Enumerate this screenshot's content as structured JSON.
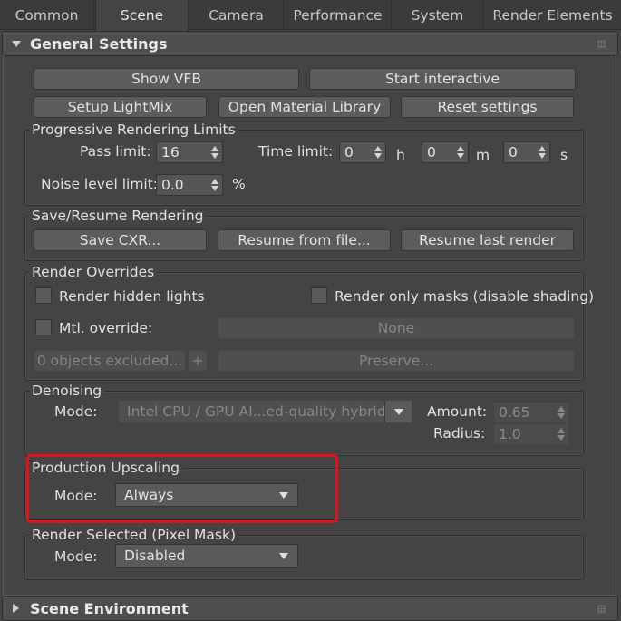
{
  "tabs": [
    "Common",
    "Scene",
    "Camera",
    "Performance",
    "System",
    "Render Elements"
  ],
  "active_tab": "Scene",
  "general": {
    "title": "General Settings",
    "show_vfb": "Show VFB",
    "start_interactive": "Start interactive",
    "setup_lightmix": "Setup LightMix",
    "open_material_library": "Open Material Library",
    "reset_settings": "Reset settings"
  },
  "progressive": {
    "title": "Progressive Rendering Limits",
    "pass_limit_label": "Pass limit:",
    "pass_limit_value": "16",
    "time_limit_label": "Time limit:",
    "hours_value": "0",
    "hours_unit": "h",
    "minutes_value": "0",
    "minutes_unit": "m",
    "seconds_value": "0",
    "seconds_unit": "s",
    "noise_label": "Noise level limit:",
    "noise_value": "0.0",
    "noise_unit": "%"
  },
  "save_resume": {
    "title": "Save/Resume Rendering",
    "save_cxr": "Save CXR...",
    "resume_from_file": "Resume from file...",
    "resume_last": "Resume last render"
  },
  "overrides": {
    "title": "Render Overrides",
    "render_hidden_lights": "Render hidden lights",
    "render_only_masks": "Render only masks (disable shading)",
    "mtl_override": "Mtl. override:",
    "mtl_value": "None",
    "objects_excluded": "0 objects excluded...",
    "add": "+",
    "preserve": "Preserve..."
  },
  "denoising": {
    "title": "Denoising",
    "mode_label": "Mode:",
    "mode_value": "Intel CPU / GPU AI...ed-quality hybrid)",
    "amount_label": "Amount:",
    "amount_value": "0.65",
    "radius_label": "Radius:",
    "radius_value": "1.0"
  },
  "upscaling": {
    "title": "Production Upscaling",
    "mode_label": "Mode:",
    "mode_value": "Always"
  },
  "render_selected": {
    "title": "Render Selected (Pixel Mask)",
    "mode_label": "Mode:",
    "mode_value": "Disabled"
  },
  "scene_env": {
    "title": "Scene Environment"
  },
  "colors": {
    "highlight": "#e3121a"
  }
}
